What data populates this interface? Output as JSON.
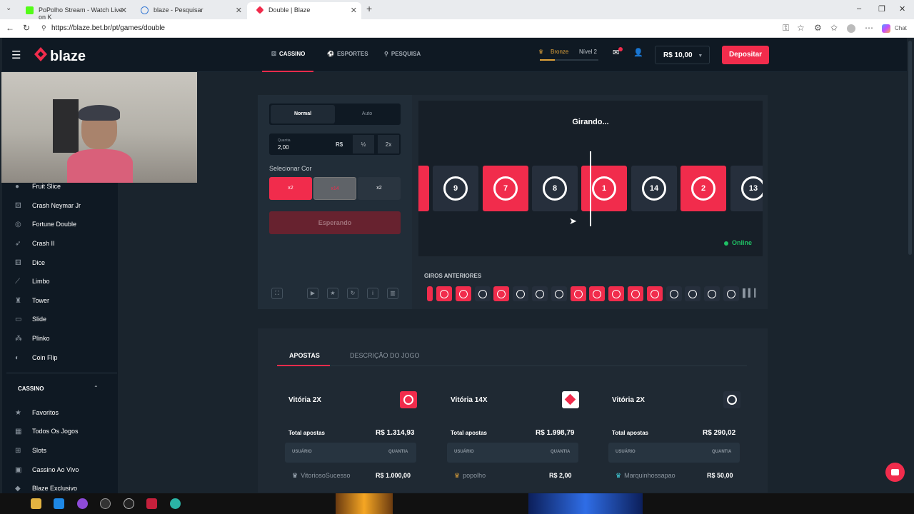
{
  "browser": {
    "tabs": [
      {
        "label": "PoPolho Stream - Watch Live on K",
        "color": "#53fc18"
      },
      {
        "label": "blaze - Pesquisar",
        "color": "#3a7bd5"
      },
      {
        "label": "Double | Blaze",
        "color": "#f12c4c"
      }
    ],
    "url": "https://blaze.bet.br/pt/games/double",
    "chat_label": "Chat"
  },
  "header": {
    "brand": "blaze",
    "nav": [
      "CASSINO",
      "ESPORTES",
      "PESQUISA"
    ],
    "rank": "Bronze",
    "level": "Nível 2",
    "balance": "R$ 10,00",
    "deposit": "Depositar",
    "accent": "#f12c4c"
  },
  "sidebar": {
    "games": [
      "Fruit Slice",
      "Crash Neymar Jr",
      "Fortune Double",
      "Crash II",
      "Dice",
      "Limbo",
      "Tower",
      "Slide",
      "Plinko",
      "Coin Flip"
    ],
    "section": "CASSINO",
    "casino_items": [
      "Favoritos",
      "Todos Os Jogos",
      "Slots",
      "Cassino Ao Vivo",
      "Blaze Exclusivo"
    ]
  },
  "controls": {
    "modes": [
      "Normal",
      "Auto"
    ],
    "amount_label": "Quantia",
    "amount": "2,00",
    "currency": "R$",
    "half": "½",
    "double": "2x",
    "select_color": "Selecionar Cor",
    "colors": [
      "x2",
      "x14",
      "x2"
    ],
    "waiting": "Esperando"
  },
  "wheel": {
    "status": "Girando...",
    "tiles": [
      {
        "n": "9",
        "c": "black"
      },
      {
        "n": "7",
        "c": "red"
      },
      {
        "n": "8",
        "c": "black"
      },
      {
        "n": "1",
        "c": "red"
      },
      {
        "n": "14",
        "c": "black"
      },
      {
        "n": "2",
        "c": "red"
      },
      {
        "n": "13",
        "c": "black"
      }
    ],
    "online": "Online"
  },
  "previous": {
    "label": "GIROS ANTERIORES",
    "rolls": [
      "red",
      "red",
      "black",
      "red",
      "black",
      "black",
      "black",
      "red",
      "red",
      "red",
      "red",
      "red",
      "black",
      "black",
      "black",
      "black"
    ]
  },
  "bets": {
    "tabs": [
      "APOSTAS",
      "DESCRIÇÃO DO JOGO"
    ],
    "total_label": "Total apostas",
    "user_head": "USUÁRIO",
    "qty_head": "QUANTIA",
    "cards": [
      {
        "title": "Vitória 2X",
        "total": "R$ 1.314,93",
        "user": "VitoriosoSucesso",
        "amount": "R$ 1.000,00"
      },
      {
        "title": "Vitória 14X",
        "total": "R$ 1.998,79",
        "user": "popolho",
        "amount": "R$ 2,00"
      },
      {
        "title": "Vitória 2X",
        "total": "R$ 290,02",
        "user": "Marquinhossapao",
        "amount": "R$ 50,00"
      }
    ]
  }
}
